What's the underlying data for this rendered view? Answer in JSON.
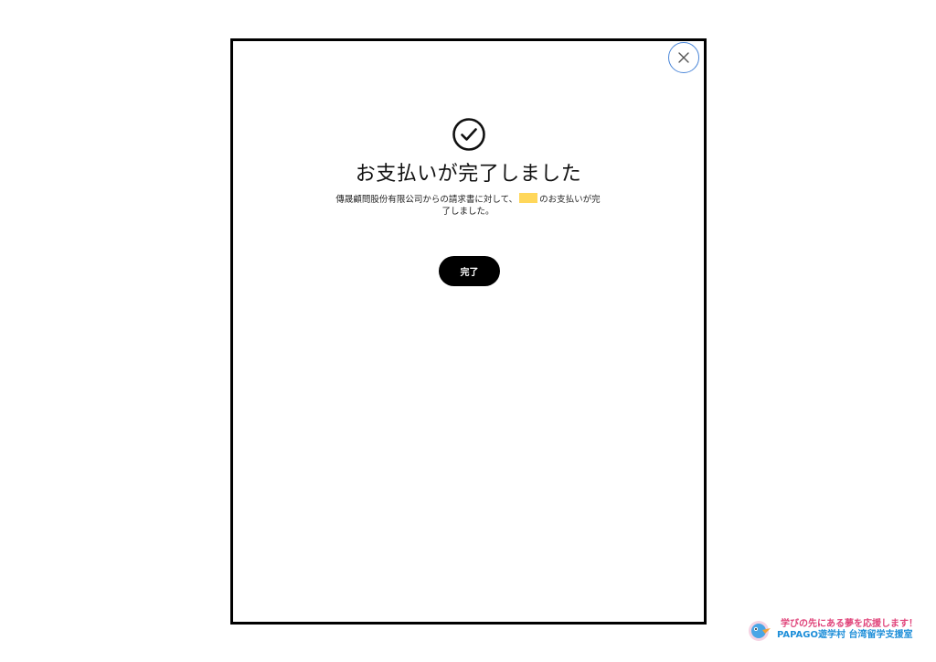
{
  "dialog": {
    "title": "お支払いが完了しました",
    "message_before": "傳晟顧問股份有限公司からの請求書に対して、",
    "message_after": "のお支払いが完了しました。",
    "done_label": "完了",
    "close_icon": "close-icon",
    "status_icon": "check-circle-icon"
  },
  "footer": {
    "tagline": "学びの先にある夢を応援します！",
    "brand": "PAPAGO遊学村 台湾留学支援室"
  },
  "colors": {
    "border": "#000000",
    "close_ring": "#4a86d8",
    "highlight": "#ffd75a",
    "button_bg": "#000000",
    "button_text": "#ffffff",
    "tagline": "#e0457b",
    "brand": "#1f8fd9"
  }
}
